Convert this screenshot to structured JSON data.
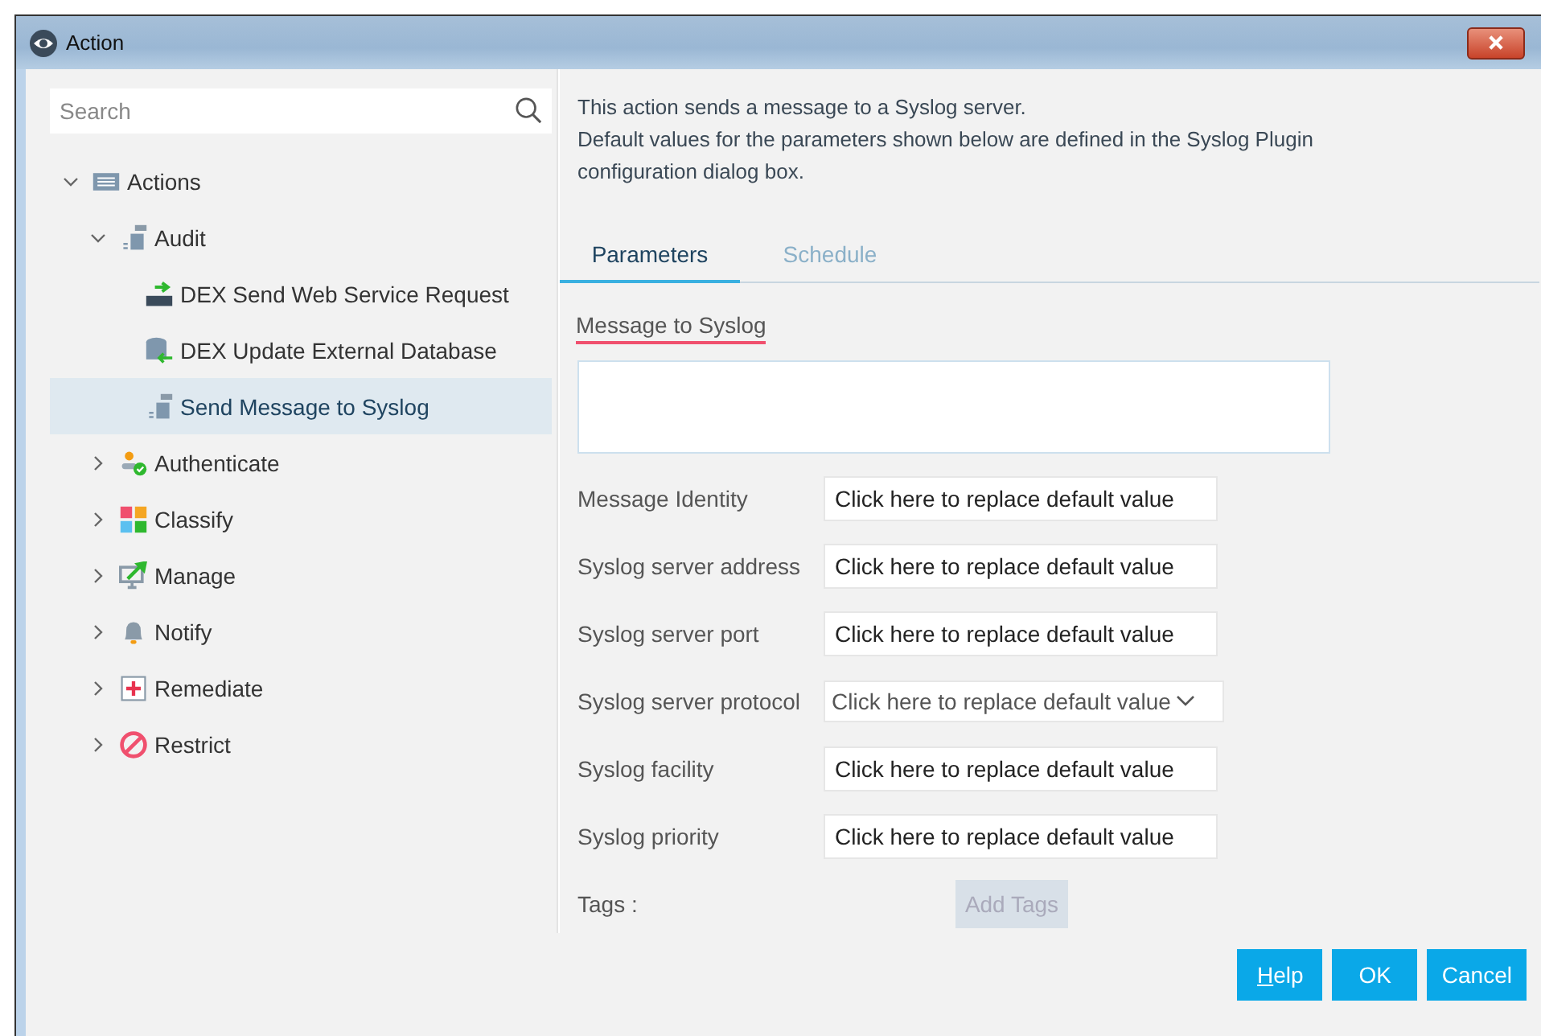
{
  "window": {
    "title": "Action"
  },
  "search": {
    "placeholder": "Search"
  },
  "tree": [
    {
      "label": "Actions",
      "kind": "list",
      "expanded": true,
      "selected": false,
      "children": [
        {
          "label": "Audit",
          "kind": "log",
          "expanded": true,
          "selected": false,
          "children": [
            {
              "label": "DEX Send Web Service Request",
              "kind": "http",
              "selected": false
            },
            {
              "label": "DEX Update External Database",
              "kind": "database",
              "selected": false
            },
            {
              "label": "Send Message to Syslog",
              "kind": "log",
              "selected": true
            }
          ]
        },
        {
          "label": "Authenticate",
          "kind": "person",
          "expanded": false,
          "selected": false
        },
        {
          "label": "Classify",
          "kind": "grid",
          "expanded": false,
          "selected": false
        },
        {
          "label": "Manage",
          "kind": "monitor",
          "expanded": false,
          "selected": false
        },
        {
          "label": "Notify",
          "kind": "bell",
          "expanded": false,
          "selected": false
        },
        {
          "label": "Remediate",
          "kind": "plus",
          "expanded": false,
          "selected": false
        },
        {
          "label": "Restrict",
          "kind": "prohibit",
          "expanded": false,
          "selected": false
        }
      ]
    }
  ],
  "description": [
    "This action sends a message to a Syslog server.",
    "Default values for the parameters shown below are defined in the Syslog Plugin configuration dialog box."
  ],
  "tabs": [
    {
      "label": "Parameters",
      "selected": true
    },
    {
      "label": "Schedule",
      "selected": false
    }
  ],
  "message": {
    "label": "Message to Syslog"
  },
  "fields": [
    {
      "label": "Message Identity",
      "kind": "text",
      "value": "Click here to replace default value"
    },
    {
      "label": "Syslog server address",
      "kind": "text",
      "value": "Click here to replace default value"
    },
    {
      "label": "Syslog server port",
      "kind": "text",
      "value": "Click here to replace default value"
    },
    {
      "label": "Syslog server protocol",
      "kind": "select",
      "value": "Click here to replace default value"
    },
    {
      "label": "Syslog facility",
      "kind": "text",
      "value": "Click here to replace default value"
    },
    {
      "label": "Syslog priority",
      "kind": "text",
      "value": "Click here to replace default value"
    }
  ],
  "tags": {
    "label": "Tags :",
    "button": "Add Tags",
    "disabled": true
  },
  "buttons": [
    {
      "label": "Help",
      "mnemonic": true
    },
    {
      "label": "OK",
      "mnemonic": false
    },
    {
      "label": "Cancel",
      "mnemonic": false
    }
  ]
}
